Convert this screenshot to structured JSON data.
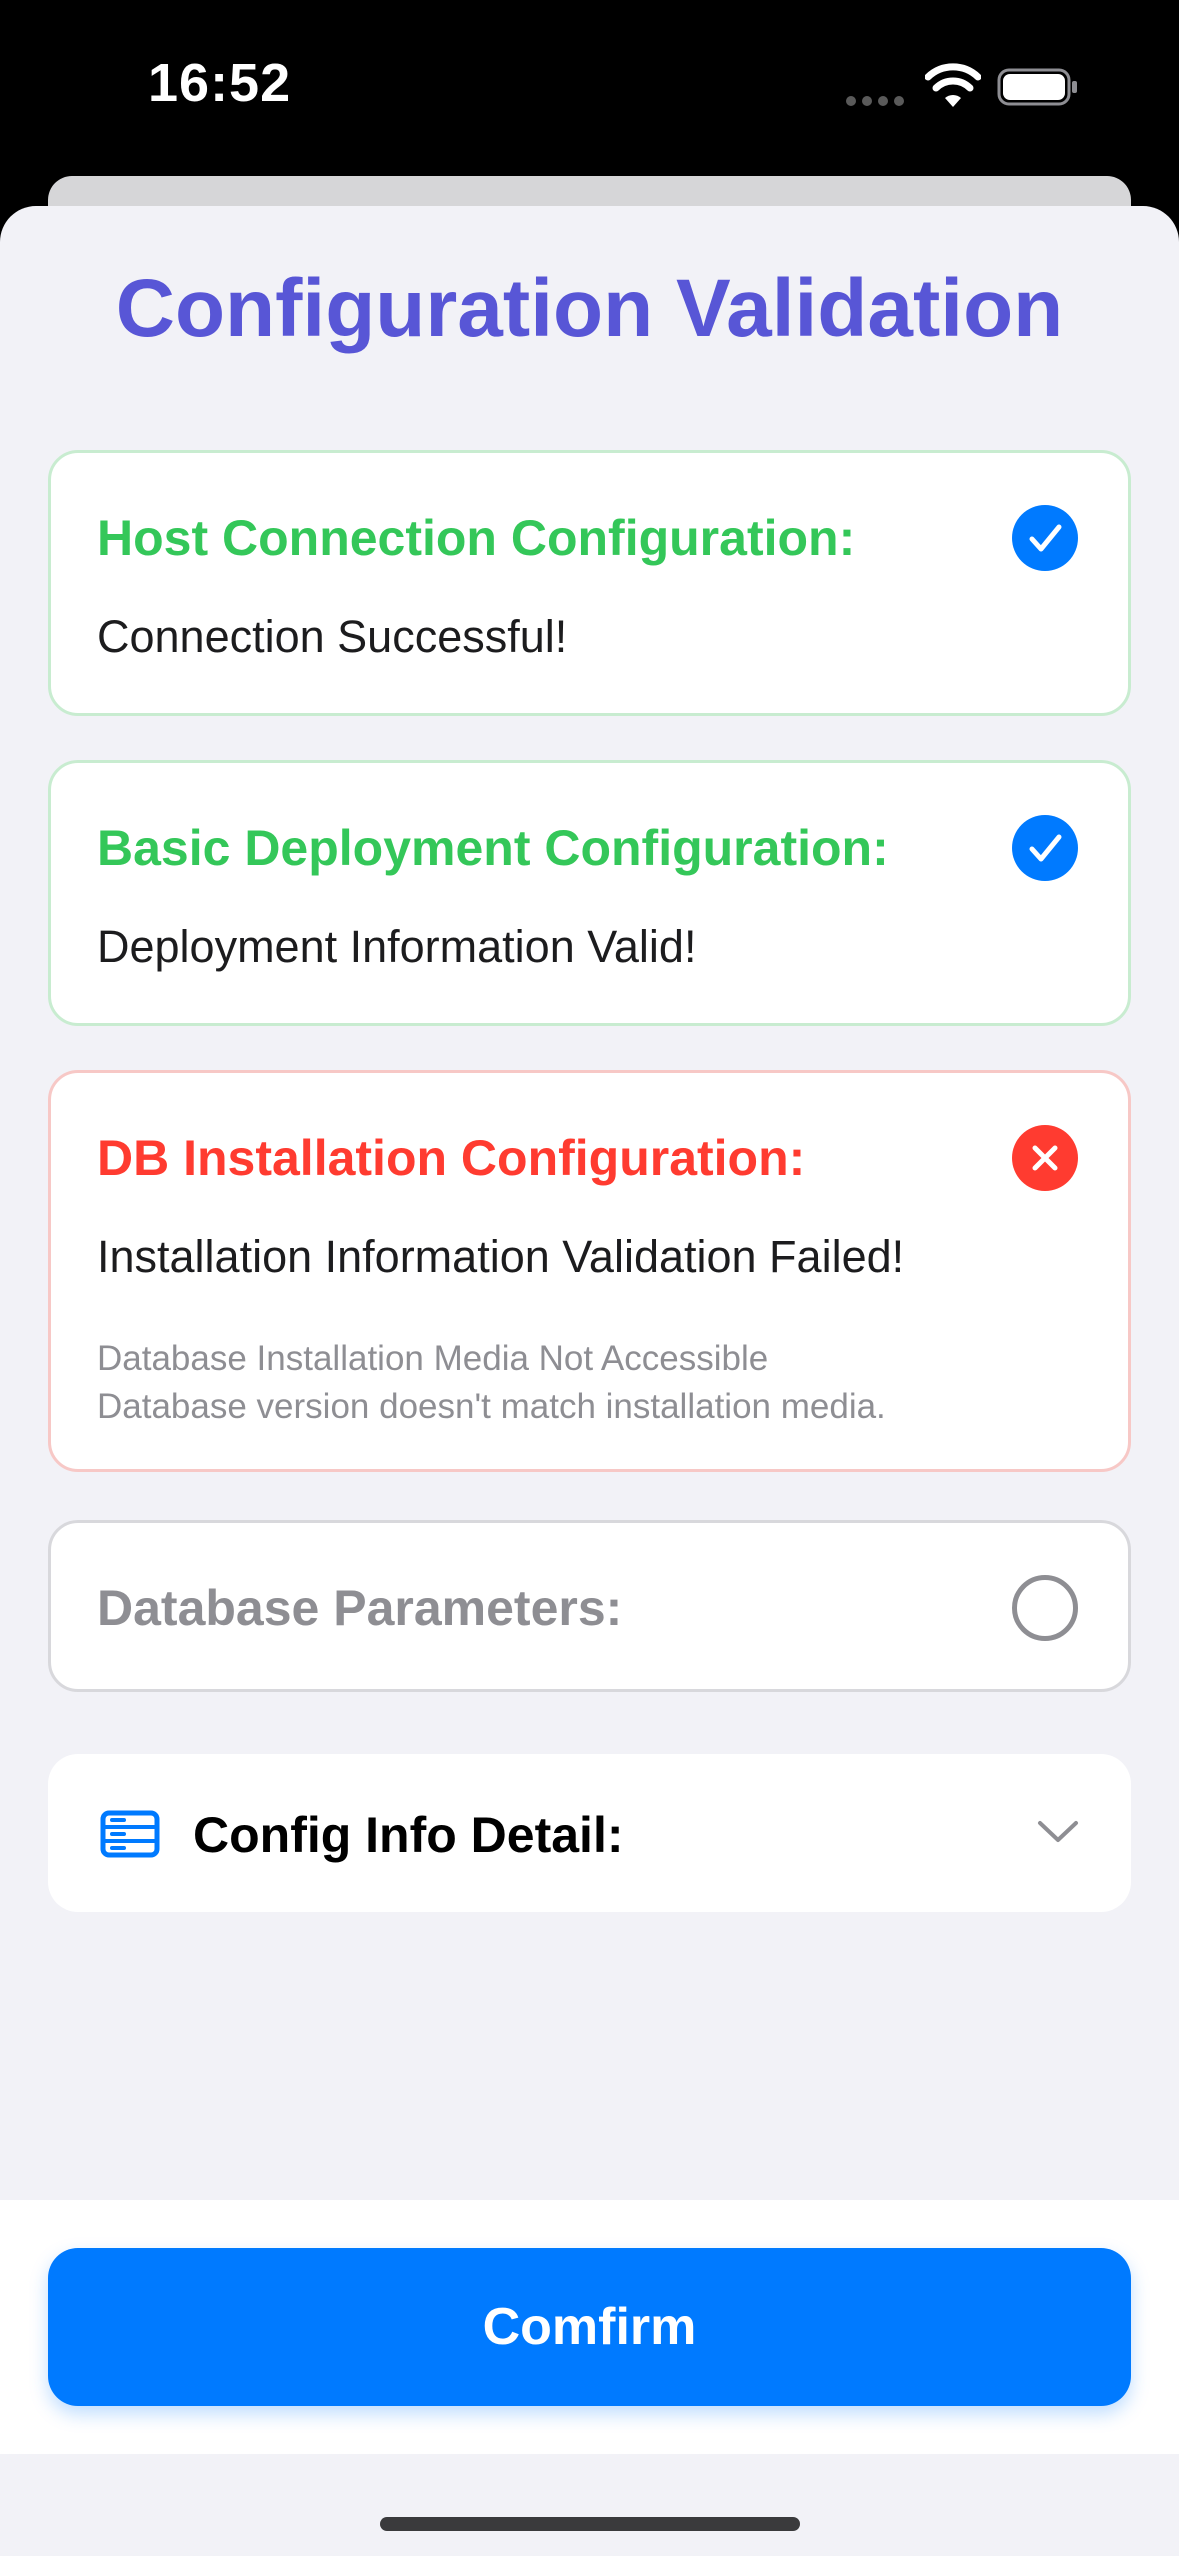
{
  "status_bar": {
    "time": "16:52"
  },
  "page": {
    "title": "Configuration Validation"
  },
  "checks": [
    {
      "title": "Host Connection Configuration:",
      "message": "Connection Successful!",
      "status": "success",
      "icon": "checkmark-circle-icon"
    },
    {
      "title": "Basic Deployment Configuration:",
      "message": "Deployment Information Valid!",
      "status": "success",
      "icon": "checkmark-circle-icon"
    },
    {
      "title": "DB Installation Configuration:",
      "message": "Installation Information Validation Failed!",
      "status": "error",
      "icon": "xmark-circle-icon",
      "errors": [
        "Database Installation Media Not Accessible",
        "Database version doesn't match installation media."
      ]
    },
    {
      "title": "Database Parameters:",
      "status": "pending",
      "icon": "empty-circle-icon"
    }
  ],
  "detail": {
    "label": "Config Info Detail:",
    "icon": "server-rack-icon",
    "expanded": false
  },
  "footer": {
    "confirm_label": "Comfirm"
  },
  "colors": {
    "accent": "#007aff",
    "title": "#5856d6",
    "success": "#34c759",
    "error": "#ff3b30",
    "pending": "#8e8e93",
    "background": "#f2f2f7"
  }
}
